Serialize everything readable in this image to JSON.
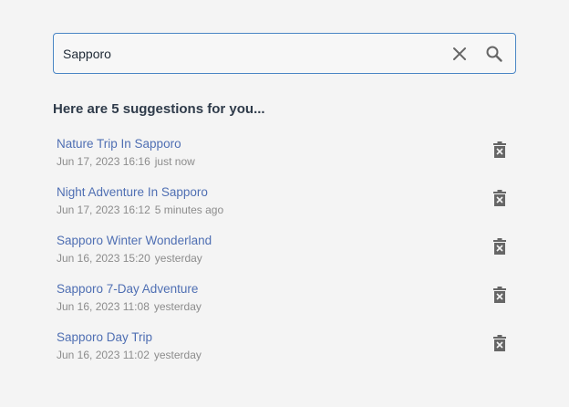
{
  "search": {
    "value": "Sapporo",
    "clear_icon": "close-icon",
    "search_icon": "search-icon"
  },
  "heading": "Here are 5 suggestions for you...",
  "suggestions": [
    {
      "title": "Nature Trip In Sapporo",
      "date": "Jun 17, 2023 16:16",
      "relative": "just now"
    },
    {
      "title": "Night Adventure In Sapporo",
      "date": "Jun 17, 2023 16:12",
      "relative": "5 minutes ago"
    },
    {
      "title": "Sapporo Winter Wonderland",
      "date": "Jun 16, 2023 15:20",
      "relative": "yesterday"
    },
    {
      "title": "Sapporo 7-Day Adventure",
      "date": "Jun 16, 2023 11:08",
      "relative": "yesterday"
    },
    {
      "title": "Sapporo Day Trip",
      "date": "Jun 16, 2023 11:02",
      "relative": "yesterday"
    }
  ],
  "colors": {
    "link": "#4f6fb3",
    "border": "#4a86c5",
    "meta": "#8c8c8c",
    "icon": "#666666"
  }
}
